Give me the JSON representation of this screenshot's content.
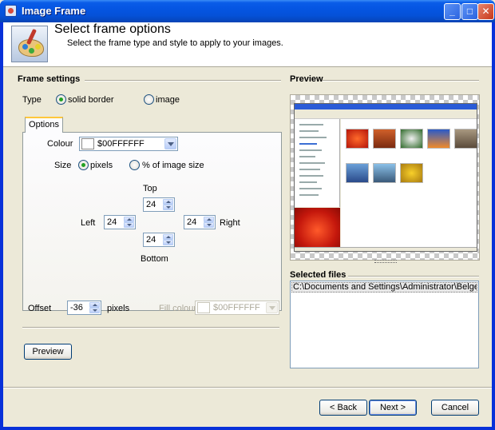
{
  "window": {
    "title": "Image Frame"
  },
  "header": {
    "title": "Select frame options",
    "subtitle": "Select the frame type and style to apply to your images."
  },
  "frame_settings": {
    "section_label": "Frame settings",
    "type_label": "Type",
    "type_options": [
      {
        "label": "solid border",
        "selected": true
      },
      {
        "label": "image",
        "selected": false
      }
    ],
    "tab_label": "Options",
    "colour_label": "Colour",
    "colour_value": "$00FFFFFF",
    "size_label": "Size",
    "size_options": [
      {
        "label": "pixels",
        "selected": true
      },
      {
        "label": "% of image size",
        "selected": false
      }
    ],
    "top_label": "Top",
    "top_value": "24",
    "left_label": "Left",
    "left_value": "24",
    "right_label": "Right",
    "right_value": "24",
    "bottom_label": "Bottom",
    "bottom_value": "24",
    "offset_label": "Offset",
    "offset_value": "-36",
    "offset_unit": "pixels",
    "fill_colour_label": "Fill colour",
    "fill_colour_value": "$00FFFFFF",
    "preview_button": "Preview"
  },
  "preview": {
    "section_label": "Preview"
  },
  "selected_files": {
    "section_label": "Selected files",
    "items": [
      "C:\\Documents and Settings\\Administrator\\Belgelerim\\Resim"
    ]
  },
  "footer": {
    "back_button": "< Back",
    "next_button": "Next >",
    "cancel_button": "Cancel"
  },
  "colors": {
    "titlebar": "#0555e2",
    "dialog_bg": "#ece9d8",
    "radio_selected": "#21a121",
    "tab_highlight": "#ffc73c"
  }
}
